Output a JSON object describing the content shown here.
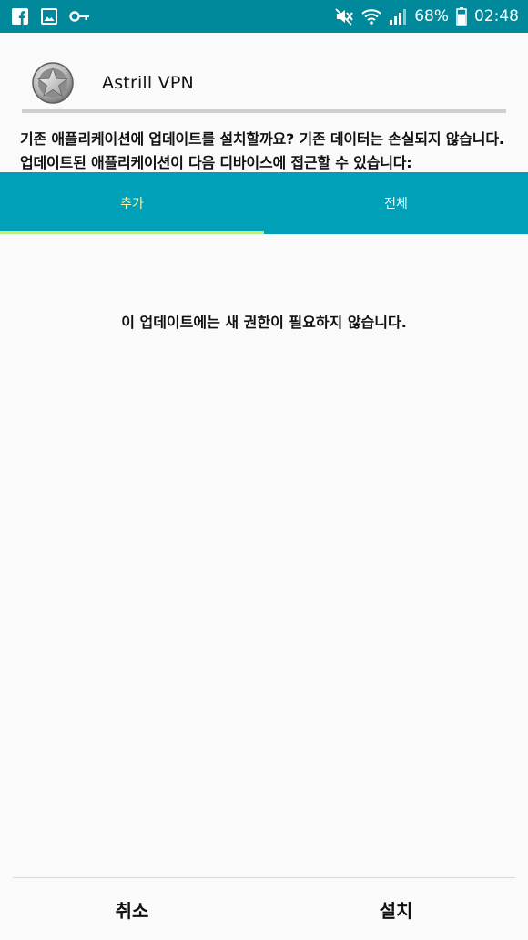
{
  "status_bar": {
    "icons_left": [
      "facebook-icon",
      "gallery-icon",
      "vpn-key-icon"
    ],
    "icons_right": [
      "mute-icon",
      "wifi-icon",
      "signal-icon",
      "battery-icon"
    ],
    "battery": "68%",
    "time": "02:48",
    "background": "#00899b"
  },
  "app": {
    "name": "Astrill VPN",
    "icon": "astrill-star-icon"
  },
  "description": "기존 애플리케이션에 업데이트를 설치할까요? 기존 데이터는 손실되지 않습니다. 업데이트된 애플리케이션이 다음 디바이스에 접근할 수 있습니다:",
  "tabs": [
    {
      "label": "추가",
      "active": true
    },
    {
      "label": "전체",
      "active": false
    }
  ],
  "tab_colors": {
    "background": "#00a0b8",
    "active_text": "#f4f3a6",
    "indicator": "#b6f28a"
  },
  "content": {
    "message": "이 업데이트에는 새 권한이 필요하지 않습니다."
  },
  "buttons": {
    "cancel": "취소",
    "install": "설치"
  }
}
